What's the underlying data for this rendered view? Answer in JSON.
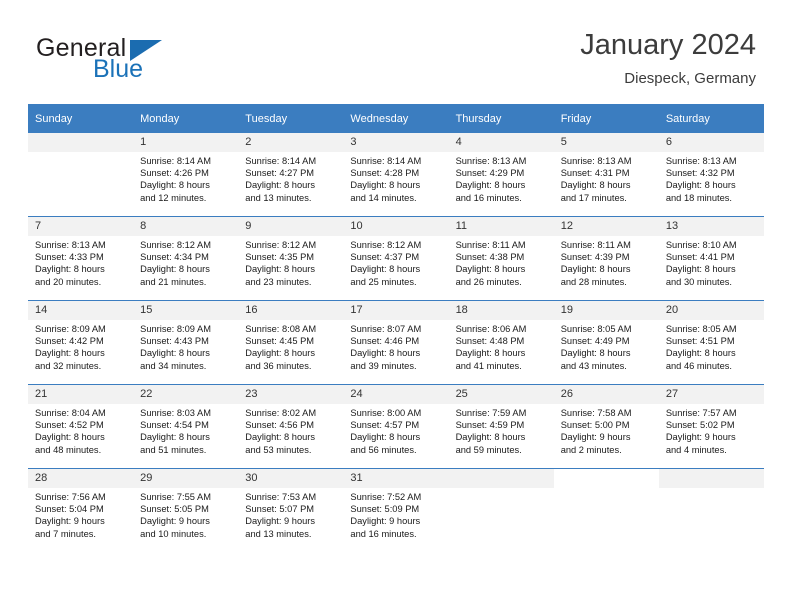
{
  "brand": {
    "word_one": "General",
    "word_two": "Blue",
    "logo_icon": "triangle-logo-icon",
    "primary_color": "#1b6cb0",
    "text_color": "#231f20"
  },
  "header": {
    "title": "January 2024",
    "subtitle": "Diespeck, Germany"
  },
  "theme": {
    "header_bg": "#3b7dc0",
    "header_text": "#ffffff",
    "daynum_bg": "#f2f2f2",
    "grid_line": "#3b7dc0"
  },
  "weekday_headers": [
    "Sunday",
    "Monday",
    "Tuesday",
    "Wednesday",
    "Thursday",
    "Friday",
    "Saturday"
  ],
  "labels": {
    "sunrise_prefix": "Sunrise:",
    "sunset_prefix": "Sunset:",
    "daylight_prefix": "Daylight:"
  },
  "weeks": [
    [
      {
        "day": "",
        "lines": []
      },
      {
        "day": "1",
        "lines": [
          "Sunrise: 8:14 AM",
          "Sunset: 4:26 PM",
          "Daylight: 8 hours",
          "and 12 minutes."
        ]
      },
      {
        "day": "2",
        "lines": [
          "Sunrise: 8:14 AM",
          "Sunset: 4:27 PM",
          "Daylight: 8 hours",
          "and 13 minutes."
        ]
      },
      {
        "day": "3",
        "lines": [
          "Sunrise: 8:14 AM",
          "Sunset: 4:28 PM",
          "Daylight: 8 hours",
          "and 14 minutes."
        ]
      },
      {
        "day": "4",
        "lines": [
          "Sunrise: 8:13 AM",
          "Sunset: 4:29 PM",
          "Daylight: 8 hours",
          "and 16 minutes."
        ]
      },
      {
        "day": "5",
        "lines": [
          "Sunrise: 8:13 AM",
          "Sunset: 4:31 PM",
          "Daylight: 8 hours",
          "and 17 minutes."
        ]
      },
      {
        "day": "6",
        "lines": [
          "Sunrise: 8:13 AM",
          "Sunset: 4:32 PM",
          "Daylight: 8 hours",
          "and 18 minutes."
        ]
      }
    ],
    [
      {
        "day": "7",
        "lines": [
          "Sunrise: 8:13 AM",
          "Sunset: 4:33 PM",
          "Daylight: 8 hours",
          "and 20 minutes."
        ]
      },
      {
        "day": "8",
        "lines": [
          "Sunrise: 8:12 AM",
          "Sunset: 4:34 PM",
          "Daylight: 8 hours",
          "and 21 minutes."
        ]
      },
      {
        "day": "9",
        "lines": [
          "Sunrise: 8:12 AM",
          "Sunset: 4:35 PM",
          "Daylight: 8 hours",
          "and 23 minutes."
        ]
      },
      {
        "day": "10",
        "lines": [
          "Sunrise: 8:12 AM",
          "Sunset: 4:37 PM",
          "Daylight: 8 hours",
          "and 25 minutes."
        ]
      },
      {
        "day": "11",
        "lines": [
          "Sunrise: 8:11 AM",
          "Sunset: 4:38 PM",
          "Daylight: 8 hours",
          "and 26 minutes."
        ]
      },
      {
        "day": "12",
        "lines": [
          "Sunrise: 8:11 AM",
          "Sunset: 4:39 PM",
          "Daylight: 8 hours",
          "and 28 minutes."
        ]
      },
      {
        "day": "13",
        "lines": [
          "Sunrise: 8:10 AM",
          "Sunset: 4:41 PM",
          "Daylight: 8 hours",
          "and 30 minutes."
        ]
      }
    ],
    [
      {
        "day": "14",
        "lines": [
          "Sunrise: 8:09 AM",
          "Sunset: 4:42 PM",
          "Daylight: 8 hours",
          "and 32 minutes."
        ]
      },
      {
        "day": "15",
        "lines": [
          "Sunrise: 8:09 AM",
          "Sunset: 4:43 PM",
          "Daylight: 8 hours",
          "and 34 minutes."
        ]
      },
      {
        "day": "16",
        "lines": [
          "Sunrise: 8:08 AM",
          "Sunset: 4:45 PM",
          "Daylight: 8 hours",
          "and 36 minutes."
        ]
      },
      {
        "day": "17",
        "lines": [
          "Sunrise: 8:07 AM",
          "Sunset: 4:46 PM",
          "Daylight: 8 hours",
          "and 39 minutes."
        ]
      },
      {
        "day": "18",
        "lines": [
          "Sunrise: 8:06 AM",
          "Sunset: 4:48 PM",
          "Daylight: 8 hours",
          "and 41 minutes."
        ]
      },
      {
        "day": "19",
        "lines": [
          "Sunrise: 8:05 AM",
          "Sunset: 4:49 PM",
          "Daylight: 8 hours",
          "and 43 minutes."
        ]
      },
      {
        "day": "20",
        "lines": [
          "Sunrise: 8:05 AM",
          "Sunset: 4:51 PM",
          "Daylight: 8 hours",
          "and 46 minutes."
        ]
      }
    ],
    [
      {
        "day": "21",
        "lines": [
          "Sunrise: 8:04 AM",
          "Sunset: 4:52 PM",
          "Daylight: 8 hours",
          "and 48 minutes."
        ]
      },
      {
        "day": "22",
        "lines": [
          "Sunrise: 8:03 AM",
          "Sunset: 4:54 PM",
          "Daylight: 8 hours",
          "and 51 minutes."
        ]
      },
      {
        "day": "23",
        "lines": [
          "Sunrise: 8:02 AM",
          "Sunset: 4:56 PM",
          "Daylight: 8 hours",
          "and 53 minutes."
        ]
      },
      {
        "day": "24",
        "lines": [
          "Sunrise: 8:00 AM",
          "Sunset: 4:57 PM",
          "Daylight: 8 hours",
          "and 56 minutes."
        ]
      },
      {
        "day": "25",
        "lines": [
          "Sunrise: 7:59 AM",
          "Sunset: 4:59 PM",
          "Daylight: 8 hours",
          "and 59 minutes."
        ]
      },
      {
        "day": "26",
        "lines": [
          "Sunrise: 7:58 AM",
          "Sunset: 5:00 PM",
          "Daylight: 9 hours",
          "and 2 minutes."
        ]
      },
      {
        "day": "27",
        "lines": [
          "Sunrise: 7:57 AM",
          "Sunset: 5:02 PM",
          "Daylight: 9 hours",
          "and 4 minutes."
        ]
      }
    ],
    [
      {
        "day": "28",
        "lines": [
          "Sunrise: 7:56 AM",
          "Sunset: 5:04 PM",
          "Daylight: 9 hours",
          "and 7 minutes."
        ]
      },
      {
        "day": "29",
        "lines": [
          "Sunrise: 7:55 AM",
          "Sunset: 5:05 PM",
          "Daylight: 9 hours",
          "and 10 minutes."
        ]
      },
      {
        "day": "30",
        "lines": [
          "Sunrise: 7:53 AM",
          "Sunset: 5:07 PM",
          "Daylight: 9 hours",
          "and 13 minutes."
        ]
      },
      {
        "day": "31",
        "lines": [
          "Sunrise: 7:52 AM",
          "Sunset: 5:09 PM",
          "Daylight: 9 hours",
          "and 16 minutes."
        ]
      },
      {
        "day": "",
        "lines": []
      },
      {
        "day": "",
        "lines": []
      },
      {
        "day": "",
        "lines": []
      }
    ]
  ]
}
